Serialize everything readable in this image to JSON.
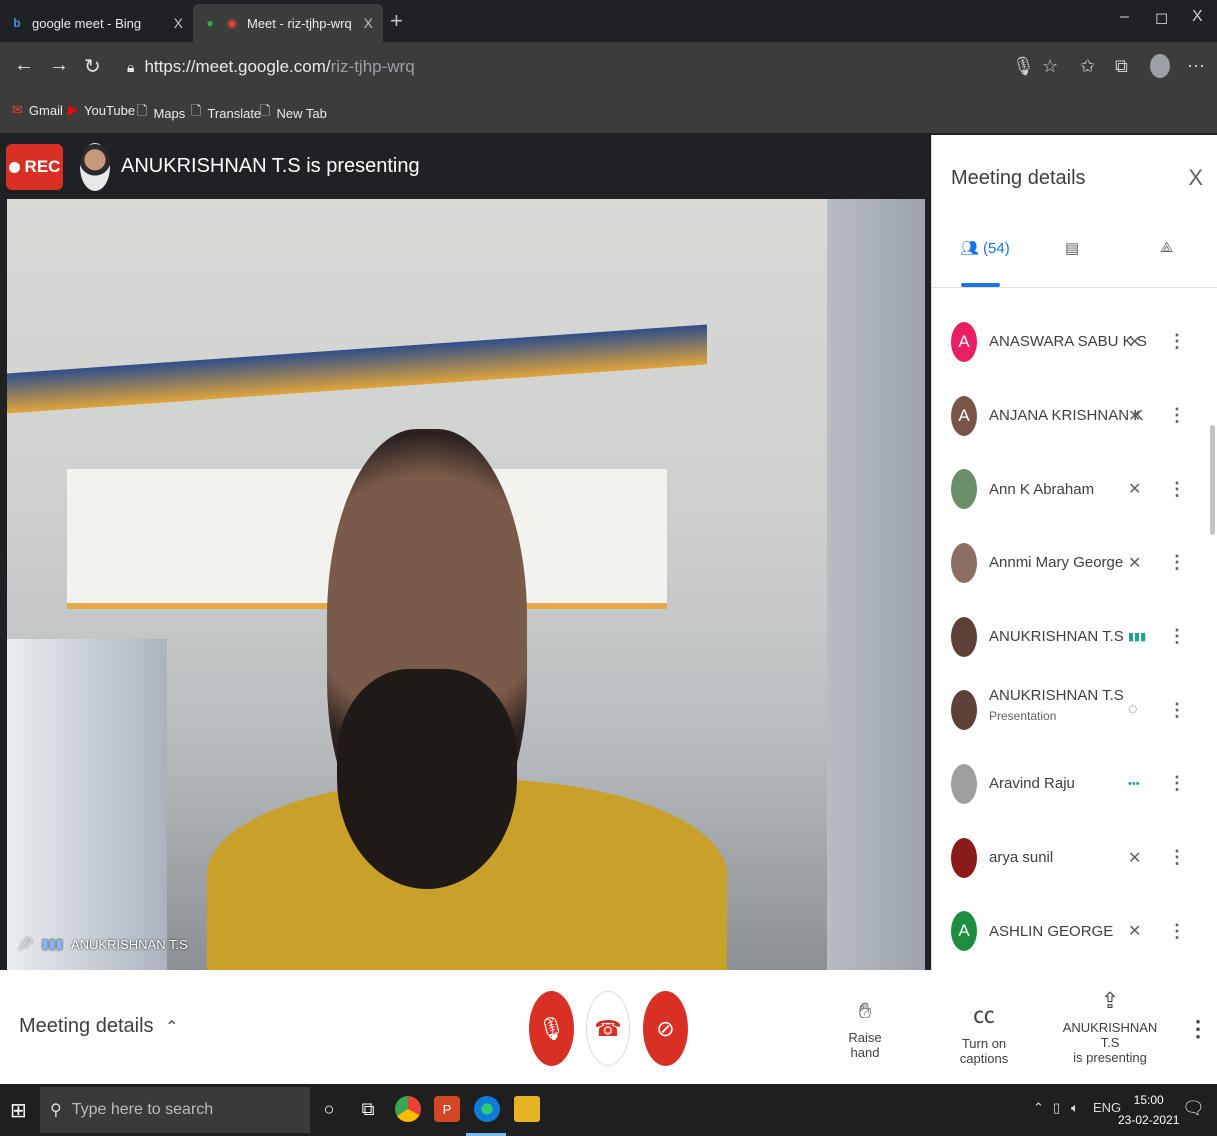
{
  "browser": {
    "tabs": [
      {
        "title": "google meet - Bing",
        "active": false,
        "close": "X"
      },
      {
        "title": "Meet - riz-tjhp-wrq",
        "active": true,
        "close": "X"
      }
    ],
    "new_tab": "+",
    "window_controls": {
      "minimize": "–",
      "restore": "◻",
      "close": "X"
    },
    "url_host": "https://meet.google.com/",
    "url_path": "riz-tjhp-wrq",
    "bookmarks": [
      "Gmail",
      "YouTube",
      "Maps",
      "Translate",
      "New Tab"
    ]
  },
  "meeting": {
    "rec_label": "REC",
    "presenting_title": "ANUKRISHNAN T.S is presenting",
    "video_label": "ANUKRISHNAN T.S"
  },
  "panel": {
    "title": "Meeting details",
    "close": "X",
    "participant_count": "(54)",
    "participants": [
      {
        "initial": "A",
        "name": "ANASWARA SABU K S",
        "sub": "",
        "color": "#e91e63",
        "mic": "muted"
      },
      {
        "initial": "A",
        "name": "ANJANA KRISHNAN K",
        "sub": "",
        "color": "#795548",
        "mic": "muted"
      },
      {
        "initial": "",
        "name": "Ann K Abraham",
        "sub": "",
        "color": "#6a8f6a",
        "mic": "muted"
      },
      {
        "initial": "",
        "name": "Annmi Mary George",
        "sub": "",
        "color": "#8d6e63",
        "mic": "muted"
      },
      {
        "initial": "",
        "name": "ANUKRISHNAN T.S",
        "sub": "",
        "color": "#5d4037",
        "mic": "speaking"
      },
      {
        "initial": "",
        "name": "ANUKRISHNAN T.S",
        "sub": "Presentation",
        "color": "#5d4037",
        "mic": "presentation"
      },
      {
        "initial": "",
        "name": "Aravind Raju",
        "sub": "",
        "color": "#9e9e9e",
        "mic": "active"
      },
      {
        "initial": "",
        "name": "arya sunil",
        "sub": "",
        "color": "#8b1a1a",
        "mic": "muted"
      },
      {
        "initial": "A",
        "name": "ASHLIN GEORGE",
        "sub": "",
        "color": "#1e8e3e",
        "mic": "muted"
      }
    ]
  },
  "controls": {
    "meeting_details": "Meeting details",
    "raise_hand": "Raise hand",
    "captions": "Turn on captions",
    "present_line1": "ANUKRISHNAN T.S",
    "present_line2": "is presenting"
  },
  "taskbar": {
    "search_placeholder": "Type here to search",
    "language": "ENG",
    "time": "15:00",
    "date": "23-02-2021"
  },
  "colors": {
    "accent": "#1a73e8",
    "rec_red": "#d93025",
    "speaking_teal": "#1aa391"
  }
}
